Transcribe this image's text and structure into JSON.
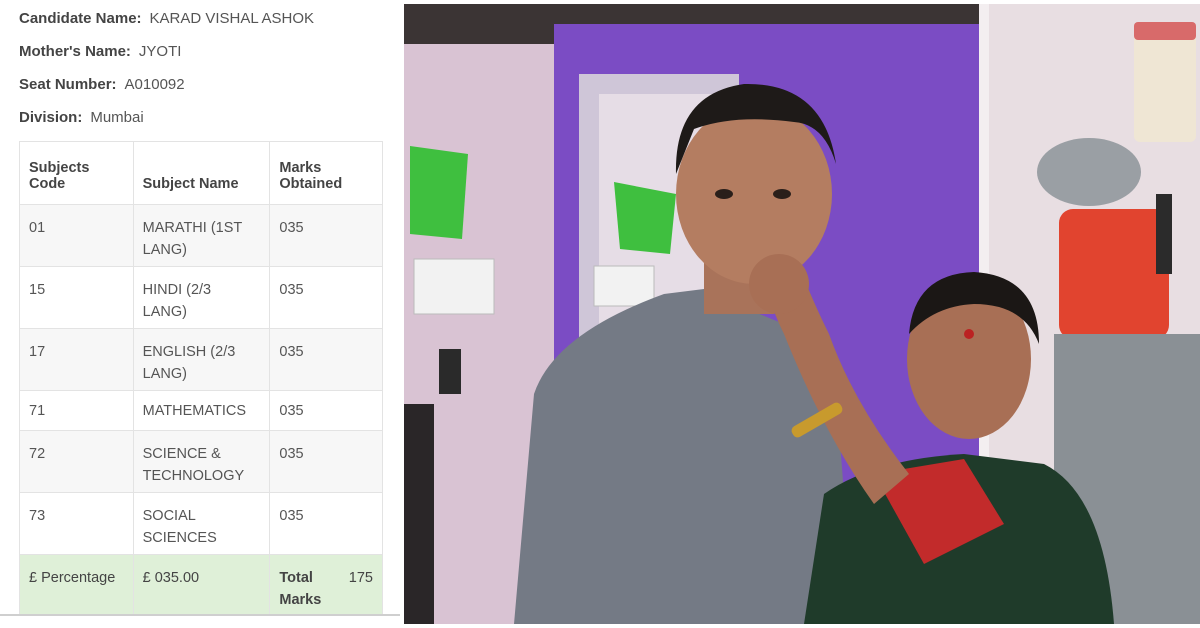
{
  "candidate": {
    "name_label": "Candidate Name:",
    "name_value": "KARAD VISHAL ASHOK",
    "mother_label": "Mother's Name:",
    "mother_value": "JYOTI",
    "seat_label": "Seat Number:",
    "seat_value": "A010092",
    "division_label": "Division:",
    "division_value": "Mumbai"
  },
  "table": {
    "headers": {
      "code": [
        "Subjects",
        "Code"
      ],
      "name": "Subject Name",
      "marks": [
        "Marks",
        "Obtained"
      ]
    },
    "rows": [
      {
        "code": "01",
        "name": [
          "MARATHI (1ST",
          "LANG)"
        ],
        "marks": "035"
      },
      {
        "code": "15",
        "name": [
          "HINDI (2/3",
          "LANG)"
        ],
        "marks": "035"
      },
      {
        "code": "17",
        "name": [
          "ENGLISH (2/3",
          "LANG)"
        ],
        "marks": "035"
      },
      {
        "code": "71",
        "name": [
          "MATHEMATICS",
          ""
        ],
        "marks": "035"
      },
      {
        "code": "72",
        "name": [
          "SCIENCE &",
          "TECHNOLOGY"
        ],
        "marks": "035"
      },
      {
        "code": "73",
        "name": [
          "SOCIAL",
          "SCIENCES"
        ],
        "marks": "035"
      }
    ],
    "footer": {
      "percentage_label": "£ Percentage",
      "percentage_value": "£ 035.00",
      "total_label": [
        "Total",
        "Marks"
      ],
      "total_value": "175"
    }
  },
  "colors": {
    "footer_bg": "#dff0d8",
    "wall_purple": "#7b4cc4",
    "wall_pink": "#dcc6d4",
    "green_hook": "#3fbf3f"
  }
}
